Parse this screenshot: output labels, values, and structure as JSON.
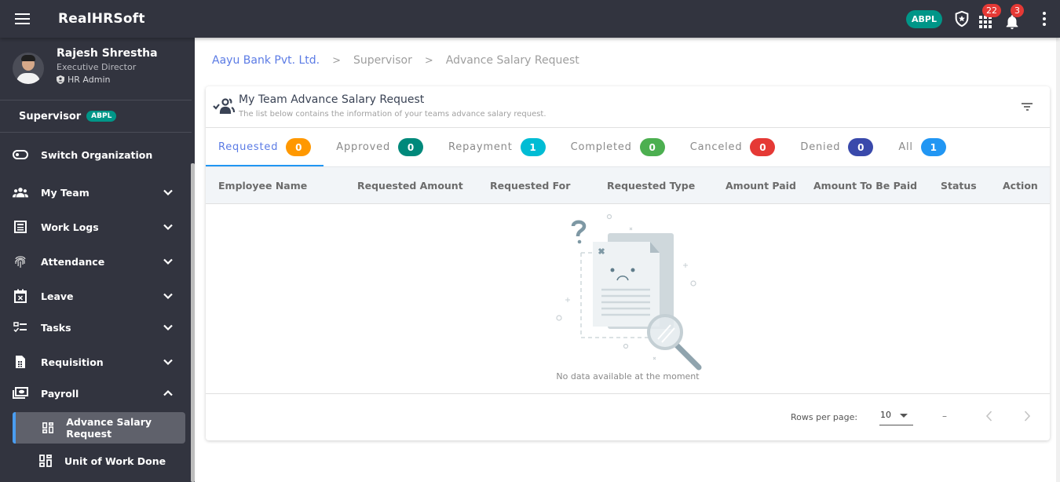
{
  "app": {
    "title": "RealHRSoft",
    "org_chip": "ABPL",
    "apps_badge": "22",
    "notifications_badge": "3"
  },
  "profile": {
    "name": "Rajesh Shrestha",
    "role": "Executive Director",
    "access": "HR Admin"
  },
  "sidebar": {
    "context_label": "Supervisor",
    "context_chip": "ABPL",
    "items": [
      {
        "label": "Switch Organization",
        "icon": "toggle-icon"
      },
      {
        "label": "My Team",
        "icon": "team-icon",
        "expandable": true
      },
      {
        "label": "Work Logs",
        "icon": "worklog-icon",
        "expandable": true
      },
      {
        "label": "Attendance",
        "icon": "fingerprint-icon",
        "expandable": true
      },
      {
        "label": "Leave",
        "icon": "calendar-x-icon",
        "expandable": true
      },
      {
        "label": "Tasks",
        "icon": "checklist-icon",
        "expandable": true
      },
      {
        "label": "Requisition",
        "icon": "document-icon",
        "expandable": true
      },
      {
        "label": "Payroll",
        "icon": "money-icon",
        "expandable": true,
        "expanded": true
      }
    ],
    "sub_items": [
      {
        "label": "Advance Salary Request",
        "icon": "dashboard-icon",
        "active": true
      },
      {
        "label": "Unit of Work Done",
        "icon": "dashboard-icon",
        "active": false
      }
    ]
  },
  "breadcrumb": {
    "org": "Aayu Bank Pvt. Ltd.",
    "section": "Supervisor",
    "page": "Advance Salary Request",
    "separator": ">"
  },
  "card": {
    "title": "My Team Advance Salary Request",
    "subtitle": "The list below contains the information of your teams advance salary request."
  },
  "tabs": [
    {
      "label": "Requested",
      "count": "0",
      "color": "#ff9800",
      "active": true
    },
    {
      "label": "Approved",
      "count": "0",
      "color": "#00897b"
    },
    {
      "label": "Repayment",
      "count": "1",
      "color": "#00bcd4"
    },
    {
      "label": "Completed",
      "count": "0",
      "color": "#4caf50"
    },
    {
      "label": "Canceled",
      "count": "0",
      "color": "#e53935"
    },
    {
      "label": "Denied",
      "count": "0",
      "color": "#3949ab"
    },
    {
      "label": "All",
      "count": "1",
      "color": "#2196f3"
    }
  ],
  "table": {
    "columns": [
      "Employee Name",
      "Requested Amount",
      "Requested For",
      "Requested Type",
      "Amount Paid",
      "Amount To Be Paid",
      "Status",
      "Action"
    ],
    "rows": [],
    "empty_text": "No data available at the moment"
  },
  "pagination": {
    "rows_per_page_label": "Rows per page:",
    "rows_per_page": "10",
    "range": "–"
  }
}
